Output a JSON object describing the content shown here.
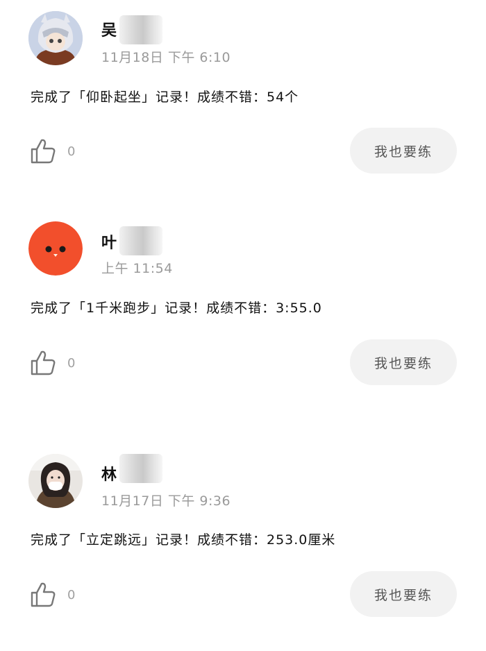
{
  "posts": [
    {
      "name": "吴",
      "time": "11月18日  下午  6:10",
      "content": "完成了「仰卧起坐」记录！成绩不错：54个",
      "like_count": "0",
      "action_label": "我也要练",
      "avatar_icon": "anime-character-avatar"
    },
    {
      "name": "叶",
      "time": "上午  11:54",
      "content": "完成了「1千米跑步」记录！成绩不错：3:55.0",
      "like_count": "0",
      "action_label": "我也要练",
      "avatar_icon": "orange-bird-face-avatar"
    },
    {
      "name": "林",
      "time": "11月17日  下午  9:36",
      "content": "完成了「立定跳远」记录！成绩不错：253.0厘米",
      "like_count": "0",
      "action_label": "我也要练",
      "avatar_icon": "user-photo-avatar"
    }
  ],
  "colors": {
    "time_text": "#9a9a9a",
    "button_bg": "#f2f2f2",
    "orange_avatar": "#f24f2c"
  }
}
